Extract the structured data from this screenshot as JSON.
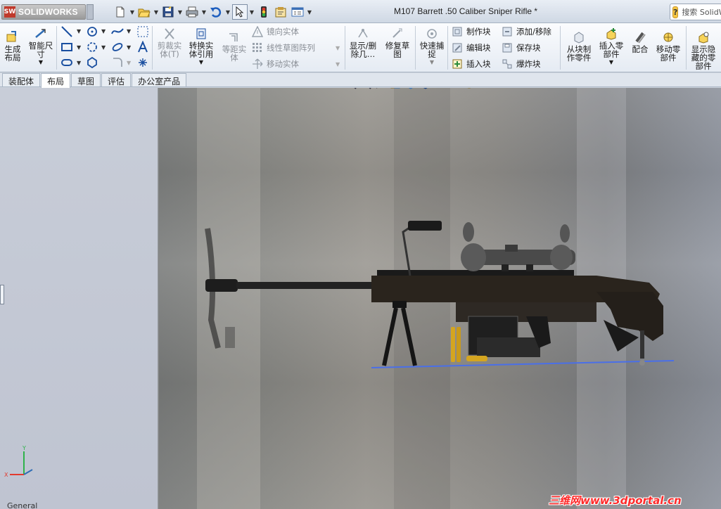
{
  "app": {
    "name": "SOLIDWORKS",
    "logo_mark": "SW"
  },
  "window": {
    "title": "M107 Barrett .50 Caliber Sniper Rifle *"
  },
  "help": {
    "search_placeholder": "搜索 SolidWorks 帮助"
  },
  "quick_access": [
    "new-document-icon",
    "open-icon",
    "save-icon",
    "print-icon",
    "undo-icon",
    "select-icon",
    "rebuild-icon",
    "options-icon"
  ],
  "ribbon": {
    "generate_layout": "生成布局",
    "smart_dimension": "智能尺寸",
    "trim_entities": "剪裁实体(T)",
    "convert_entities": "转换实体引用",
    "offset_entities": "等距实体",
    "mirror_entities": "镜向实体",
    "linear_pattern": "线性草图阵列",
    "move_entities": "移动实体",
    "show_hide": "显示/删除几…",
    "repair_sketch": "修复草图",
    "quick_snaps": "快速捕捉",
    "make_block": "制作块",
    "edit_block": "编辑块",
    "insert_block": "插入块",
    "add_remove": "添加/移除",
    "save_block": "保存块",
    "explode_block": "爆炸块",
    "make_part_from_block": "从块制作零件",
    "insert_part": "插入零部件",
    "mate": "配合",
    "move_component": "移动零部件",
    "show_hidden": "显示隐藏的零部件"
  },
  "tabs": [
    "装配体",
    "布局",
    "草图",
    "评估",
    "办公室产品"
  ],
  "active_tab": "布局",
  "viewport": {
    "watermark": "三维网www.3dportal.cn",
    "bottom_label": "General",
    "triad_axes": [
      "Y",
      "X"
    ]
  },
  "colors": {
    "accent": "#2f6db5",
    "logo_red": "#c0392b",
    "watermark_red": "#ff2a2a"
  }
}
